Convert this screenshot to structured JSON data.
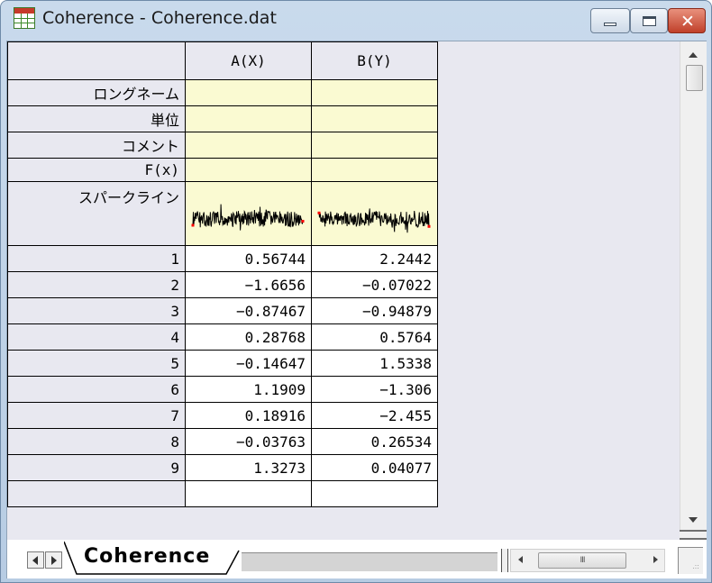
{
  "window": {
    "title": "Coherence - Coherence.dat",
    "icon": "worksheet-grid-icon",
    "controls": {
      "minimize_icon": "minimize-icon",
      "maximize_icon": "maximize-icon",
      "close_label": "✕"
    }
  },
  "sheet": {
    "columns": [
      {
        "header": "A(X)"
      },
      {
        "header": "B(Y)"
      }
    ],
    "meta_rows": [
      {
        "label": "ロングネーム",
        "values": [
          "",
          ""
        ]
      },
      {
        "label": "単位",
        "values": [
          "",
          ""
        ]
      },
      {
        "label": "コメント",
        "values": [
          "",
          ""
        ]
      },
      {
        "label": "F(x)",
        "values": [
          "",
          ""
        ]
      }
    ],
    "sparkline_row": {
      "label": "スパークライン",
      "colors": {
        "line": "#000000",
        "endpoint": "#ff0000",
        "background": "#fafad2"
      }
    },
    "rows": [
      {
        "index": "1",
        "a": "0.56744",
        "b": "2.2442"
      },
      {
        "index": "2",
        "a": "-1.6656",
        "b": "-0.07022"
      },
      {
        "index": "3",
        "a": "-0.87467",
        "b": "-0.94879"
      },
      {
        "index": "4",
        "a": "0.28768",
        "b": "0.5764"
      },
      {
        "index": "5",
        "a": "-0.14647",
        "b": "1.5338"
      },
      {
        "index": "6",
        "a": "1.1909",
        "b": "-1.306"
      },
      {
        "index": "7",
        "a": "0.18916",
        "b": "-2.455"
      },
      {
        "index": "8",
        "a": "-0.03763",
        "b": "0.26534"
      },
      {
        "index": "9",
        "a": "1.3273",
        "b": "0.04077"
      }
    ]
  },
  "tabs": {
    "active_label": "Coherence",
    "prev_icon": "tab-prev-icon",
    "next_icon": "tab-next-icon"
  },
  "hscroll": {
    "grip": "III"
  },
  "colors": {
    "meta_background": "#fafad2",
    "header_background": "#e8e8f0",
    "grid_lines": "#000000"
  }
}
